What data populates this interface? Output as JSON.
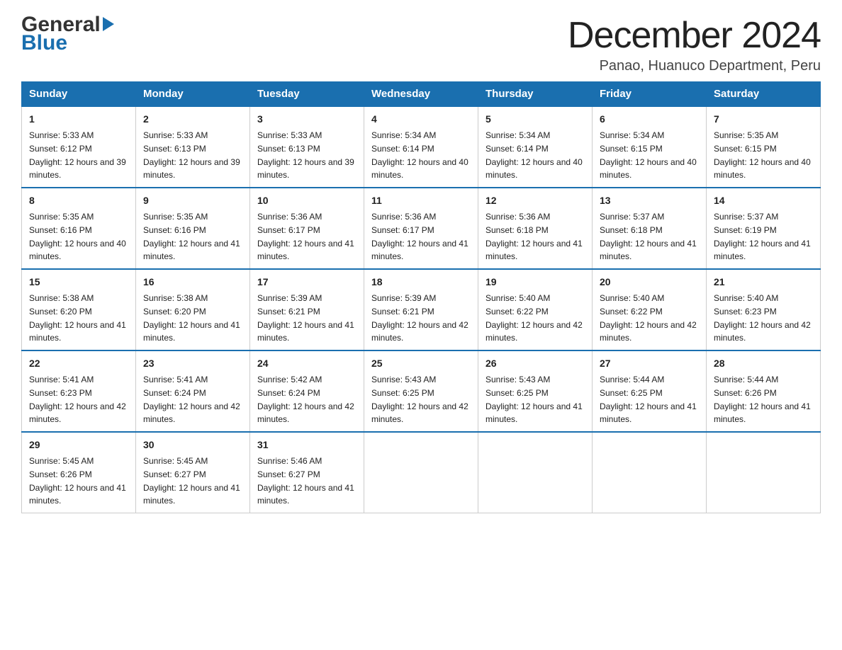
{
  "header": {
    "logo_general": "General",
    "logo_blue": "Blue",
    "title": "December 2024",
    "subtitle": "Panao, Huanuco Department, Peru"
  },
  "days_of_week": [
    "Sunday",
    "Monday",
    "Tuesday",
    "Wednesday",
    "Thursday",
    "Friday",
    "Saturday"
  ],
  "weeks": [
    [
      {
        "day": "1",
        "sunrise": "Sunrise: 5:33 AM",
        "sunset": "Sunset: 6:12 PM",
        "daylight": "Daylight: 12 hours and 39 minutes."
      },
      {
        "day": "2",
        "sunrise": "Sunrise: 5:33 AM",
        "sunset": "Sunset: 6:13 PM",
        "daylight": "Daylight: 12 hours and 39 minutes."
      },
      {
        "day": "3",
        "sunrise": "Sunrise: 5:33 AM",
        "sunset": "Sunset: 6:13 PM",
        "daylight": "Daylight: 12 hours and 39 minutes."
      },
      {
        "day": "4",
        "sunrise": "Sunrise: 5:34 AM",
        "sunset": "Sunset: 6:14 PM",
        "daylight": "Daylight: 12 hours and 40 minutes."
      },
      {
        "day": "5",
        "sunrise": "Sunrise: 5:34 AM",
        "sunset": "Sunset: 6:14 PM",
        "daylight": "Daylight: 12 hours and 40 minutes."
      },
      {
        "day": "6",
        "sunrise": "Sunrise: 5:34 AM",
        "sunset": "Sunset: 6:15 PM",
        "daylight": "Daylight: 12 hours and 40 minutes."
      },
      {
        "day": "7",
        "sunrise": "Sunrise: 5:35 AM",
        "sunset": "Sunset: 6:15 PM",
        "daylight": "Daylight: 12 hours and 40 minutes."
      }
    ],
    [
      {
        "day": "8",
        "sunrise": "Sunrise: 5:35 AM",
        "sunset": "Sunset: 6:16 PM",
        "daylight": "Daylight: 12 hours and 40 minutes."
      },
      {
        "day": "9",
        "sunrise": "Sunrise: 5:35 AM",
        "sunset": "Sunset: 6:16 PM",
        "daylight": "Daylight: 12 hours and 41 minutes."
      },
      {
        "day": "10",
        "sunrise": "Sunrise: 5:36 AM",
        "sunset": "Sunset: 6:17 PM",
        "daylight": "Daylight: 12 hours and 41 minutes."
      },
      {
        "day": "11",
        "sunrise": "Sunrise: 5:36 AM",
        "sunset": "Sunset: 6:17 PM",
        "daylight": "Daylight: 12 hours and 41 minutes."
      },
      {
        "day": "12",
        "sunrise": "Sunrise: 5:36 AM",
        "sunset": "Sunset: 6:18 PM",
        "daylight": "Daylight: 12 hours and 41 minutes."
      },
      {
        "day": "13",
        "sunrise": "Sunrise: 5:37 AM",
        "sunset": "Sunset: 6:18 PM",
        "daylight": "Daylight: 12 hours and 41 minutes."
      },
      {
        "day": "14",
        "sunrise": "Sunrise: 5:37 AM",
        "sunset": "Sunset: 6:19 PM",
        "daylight": "Daylight: 12 hours and 41 minutes."
      }
    ],
    [
      {
        "day": "15",
        "sunrise": "Sunrise: 5:38 AM",
        "sunset": "Sunset: 6:20 PM",
        "daylight": "Daylight: 12 hours and 41 minutes."
      },
      {
        "day": "16",
        "sunrise": "Sunrise: 5:38 AM",
        "sunset": "Sunset: 6:20 PM",
        "daylight": "Daylight: 12 hours and 41 minutes."
      },
      {
        "day": "17",
        "sunrise": "Sunrise: 5:39 AM",
        "sunset": "Sunset: 6:21 PM",
        "daylight": "Daylight: 12 hours and 41 minutes."
      },
      {
        "day": "18",
        "sunrise": "Sunrise: 5:39 AM",
        "sunset": "Sunset: 6:21 PM",
        "daylight": "Daylight: 12 hours and 42 minutes."
      },
      {
        "day": "19",
        "sunrise": "Sunrise: 5:40 AM",
        "sunset": "Sunset: 6:22 PM",
        "daylight": "Daylight: 12 hours and 42 minutes."
      },
      {
        "day": "20",
        "sunrise": "Sunrise: 5:40 AM",
        "sunset": "Sunset: 6:22 PM",
        "daylight": "Daylight: 12 hours and 42 minutes."
      },
      {
        "day": "21",
        "sunrise": "Sunrise: 5:40 AM",
        "sunset": "Sunset: 6:23 PM",
        "daylight": "Daylight: 12 hours and 42 minutes."
      }
    ],
    [
      {
        "day": "22",
        "sunrise": "Sunrise: 5:41 AM",
        "sunset": "Sunset: 6:23 PM",
        "daylight": "Daylight: 12 hours and 42 minutes."
      },
      {
        "day": "23",
        "sunrise": "Sunrise: 5:41 AM",
        "sunset": "Sunset: 6:24 PM",
        "daylight": "Daylight: 12 hours and 42 minutes."
      },
      {
        "day": "24",
        "sunrise": "Sunrise: 5:42 AM",
        "sunset": "Sunset: 6:24 PM",
        "daylight": "Daylight: 12 hours and 42 minutes."
      },
      {
        "day": "25",
        "sunrise": "Sunrise: 5:43 AM",
        "sunset": "Sunset: 6:25 PM",
        "daylight": "Daylight: 12 hours and 42 minutes."
      },
      {
        "day": "26",
        "sunrise": "Sunrise: 5:43 AM",
        "sunset": "Sunset: 6:25 PM",
        "daylight": "Daylight: 12 hours and 41 minutes."
      },
      {
        "day": "27",
        "sunrise": "Sunrise: 5:44 AM",
        "sunset": "Sunset: 6:25 PM",
        "daylight": "Daylight: 12 hours and 41 minutes."
      },
      {
        "day": "28",
        "sunrise": "Sunrise: 5:44 AM",
        "sunset": "Sunset: 6:26 PM",
        "daylight": "Daylight: 12 hours and 41 minutes."
      }
    ],
    [
      {
        "day": "29",
        "sunrise": "Sunrise: 5:45 AM",
        "sunset": "Sunset: 6:26 PM",
        "daylight": "Daylight: 12 hours and 41 minutes."
      },
      {
        "day": "30",
        "sunrise": "Sunrise: 5:45 AM",
        "sunset": "Sunset: 6:27 PM",
        "daylight": "Daylight: 12 hours and 41 minutes."
      },
      {
        "day": "31",
        "sunrise": "Sunrise: 5:46 AM",
        "sunset": "Sunset: 6:27 PM",
        "daylight": "Daylight: 12 hours and 41 minutes."
      },
      null,
      null,
      null,
      null
    ]
  ]
}
